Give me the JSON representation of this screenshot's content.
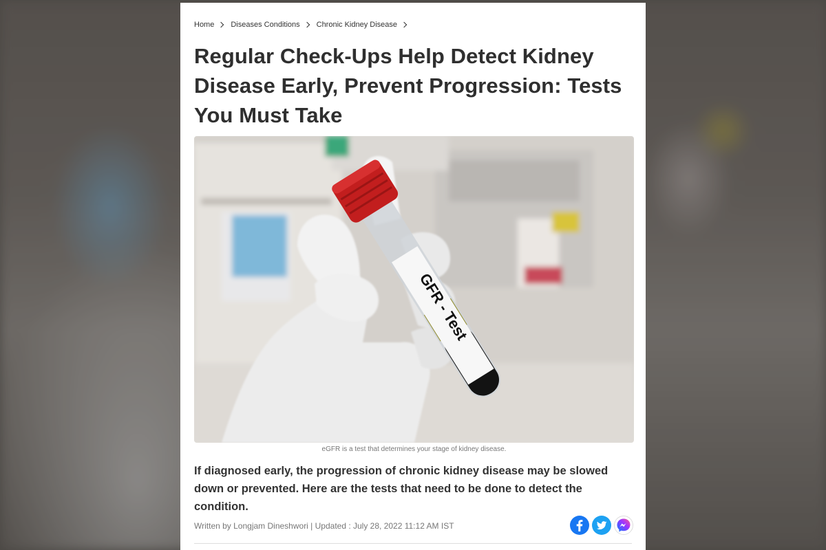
{
  "breadcrumb": {
    "items": [
      "Home",
      "Diseases Conditions",
      "Chronic Kidney Disease"
    ]
  },
  "article": {
    "title": "Regular Check-Ups Help Detect Kidney Disease Early, Prevent Progression: Tests You Must Take",
    "image": {
      "tube_label": "GFR - Test",
      "caption": "eGFR is a test that determines your stage of kidney disease."
    },
    "summary": "If diagnosed early, the progression of chronic kidney disease may be slowed down or prevented. Here are the tests that need to be done to detect the condition.",
    "byline": "Written by Longjam Dineshwori | Updated : July 28, 2022 11:12 AM IST"
  },
  "share": {
    "icons": [
      "facebook-icon",
      "twitter-icon",
      "messenger-icon"
    ],
    "colors": {
      "facebook": "#1877f2",
      "twitter": "#1da1f2",
      "messenger": "#0a7cff"
    }
  }
}
